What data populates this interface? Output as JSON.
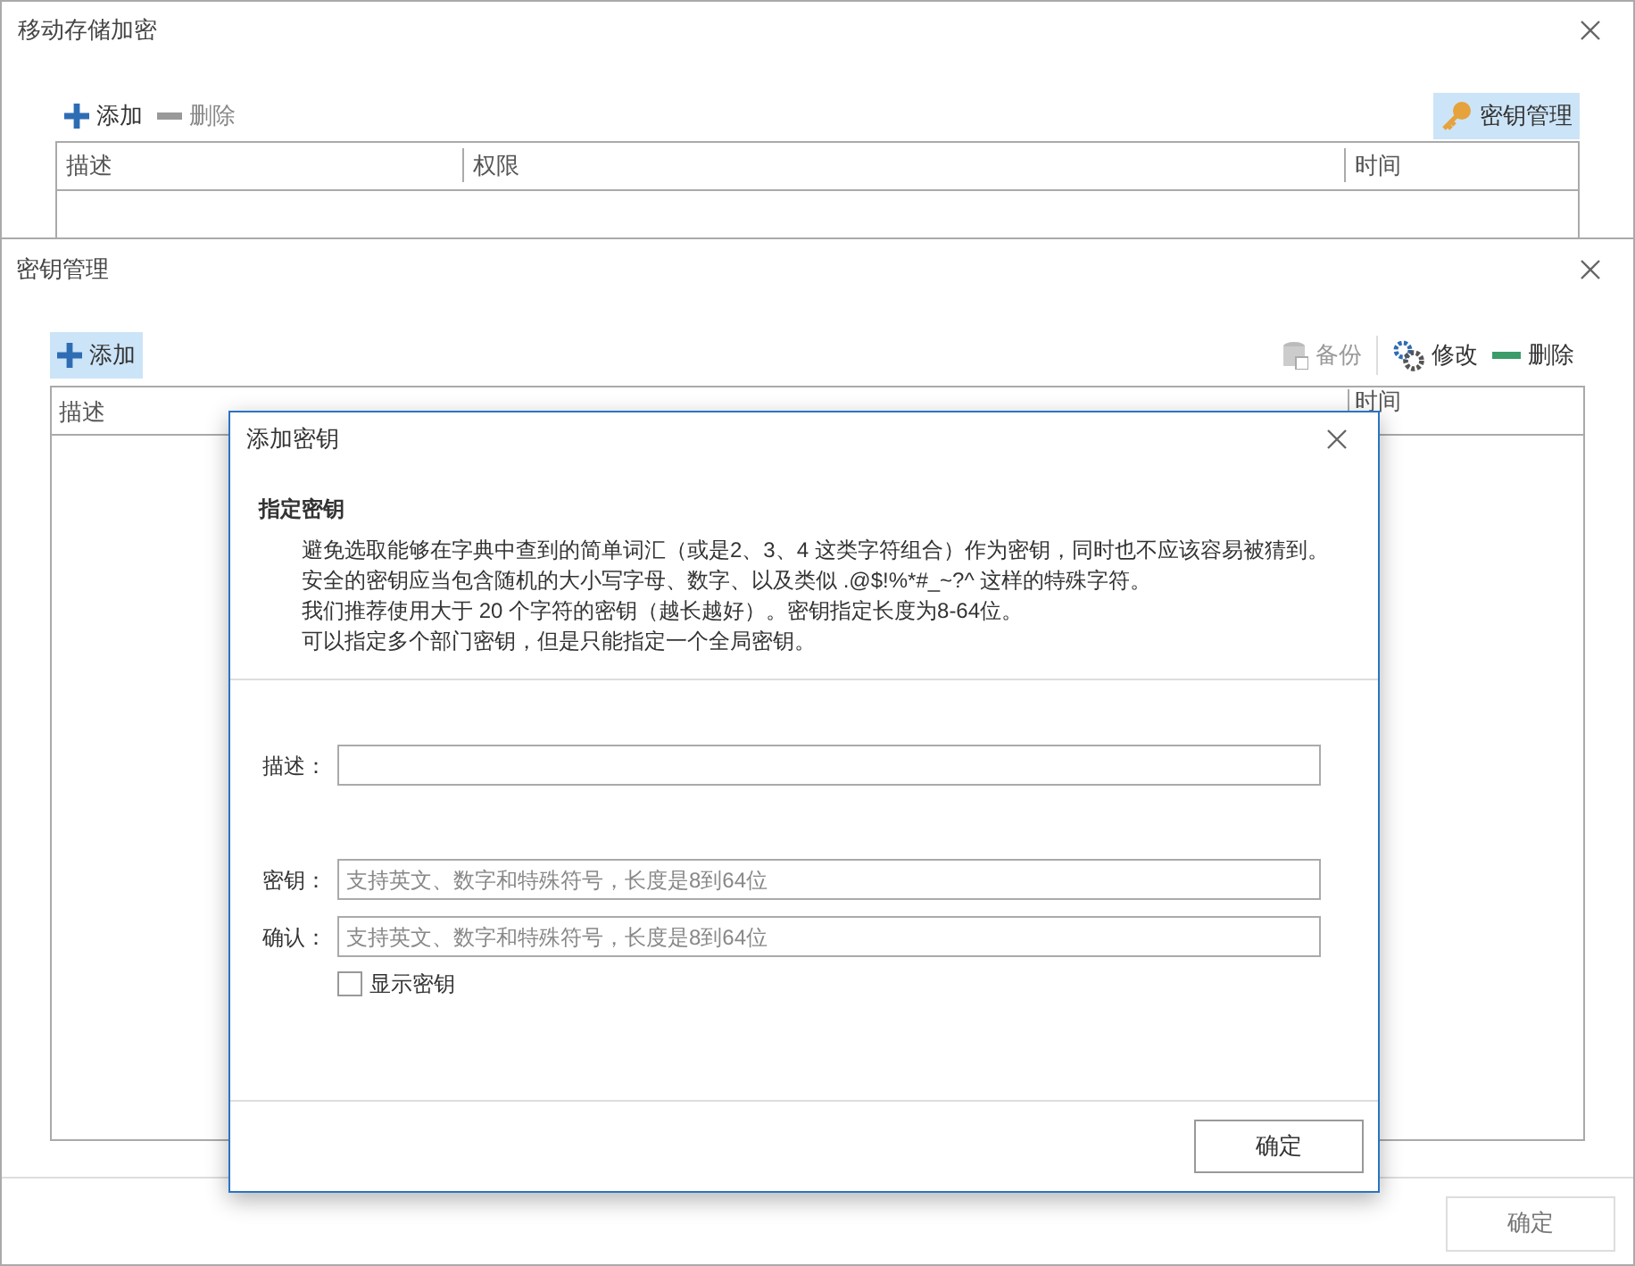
{
  "main_window": {
    "title": "移动存储加密",
    "toolbar_left": [
      {
        "label": "添加",
        "kind": "add"
      },
      {
        "label": "删除",
        "kind": "remove"
      }
    ],
    "key_button": {
      "label": "密钥管理",
      "selected": true
    },
    "table": {
      "columns": [
        "描述",
        "权限",
        "时间"
      ]
    }
  },
  "key_window": {
    "title": "密钥管理",
    "add_button": {
      "label": "添加",
      "selected": true
    },
    "toolbar_right": [
      {
        "label": "备份",
        "kind": "backup",
        "disabled": true
      },
      {
        "label": "修改",
        "kind": "edit",
        "disabled": false
      },
      {
        "label": "删除",
        "kind": "delete",
        "disabled": false
      }
    ],
    "table": {
      "columns": [
        "描述",
        "时间"
      ]
    },
    "ok_button": {
      "label": "确定",
      "disabled": true
    }
  },
  "dialog": {
    "title": "添加密钥",
    "section_title": "指定密钥",
    "paragraph": [
      "避免选取能够在字典中查到的简单词汇（或是2、3、4 这类字符组合）作为密钥，同时也不应该容易被猜到。",
      "安全的密钥应当包含随机的大小写字母、数字、以及类似 .@$!%*#_~?^ 这样的特殊字符。",
      "我们推荐使用大于 20 个字符的密钥（越长越好）。密钥指定长度为8-64位。",
      "可以指定多个部门密钥，但是只能指定一个全局密钥。"
    ],
    "fields": [
      {
        "label": "描述："
      },
      {
        "label": "密钥：",
        "placeholder": "支持英文、数字和特殊符号，长度是8到64位"
      },
      {
        "label": "确认：",
        "placeholder": "支持英文、数字和特殊符号，长度是8到64位"
      }
    ],
    "show_key": {
      "label": "显示密钥",
      "checked": false
    },
    "ok_button": {
      "label": "确定"
    }
  }
}
